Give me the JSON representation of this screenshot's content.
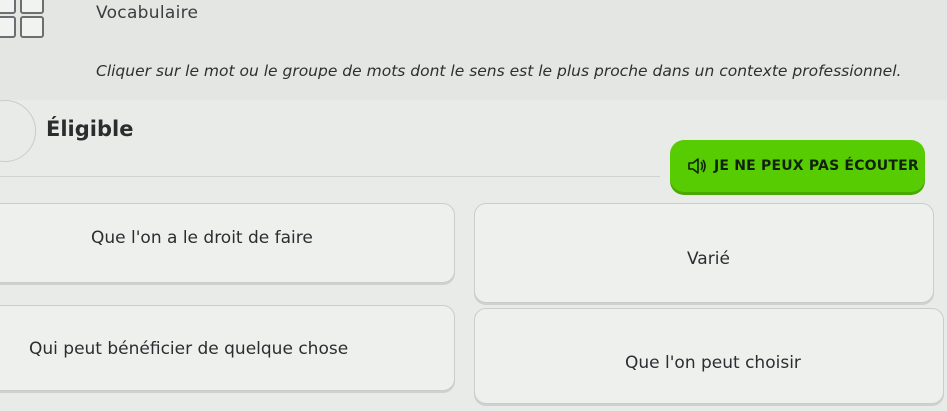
{
  "header": {
    "title": "Vocabulaire",
    "instructions": "Cliquer sur le mot ou le groupe de mots dont le sens est le plus proche dans un contexte professionnel."
  },
  "question": {
    "word": "Éligible"
  },
  "listen_button": {
    "label": "JE NE PEUX PAS ÉCOUTER",
    "icon": "speaker-muted-icon",
    "color": "#58cc02"
  },
  "options": [
    {
      "label": "Que l'on a le droit de faire"
    },
    {
      "label": "Varié"
    },
    {
      "label": "Qui peut bénéficier de quelque chose"
    },
    {
      "label": "Que l'on peut choisir"
    }
  ]
}
